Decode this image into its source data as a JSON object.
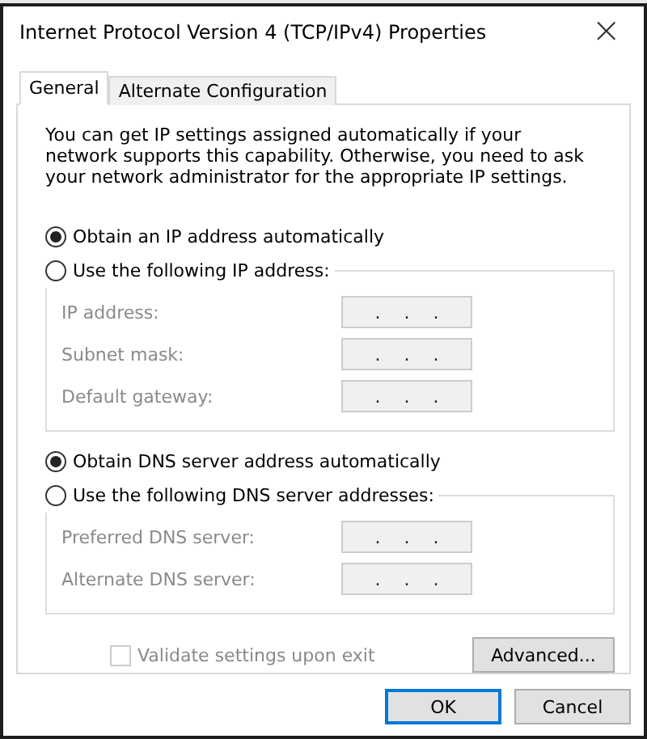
{
  "window": {
    "title": "Internet Protocol Version 4 (TCP/IPv4) Properties",
    "close": "×"
  },
  "tabs": [
    {
      "label": "General",
      "selected": true
    },
    {
      "label": "Alternate Configuration",
      "selected": false
    }
  ],
  "description": "You can get IP settings assigned automatically if your network supports this capability. Otherwise, you need to ask your network administrator for the appropriate IP settings.",
  "ip_section": {
    "auto_option": {
      "label": "Obtain an IP address automatically",
      "selected": true
    },
    "manual_option": {
      "label": "Use the following IP address:",
      "selected": false
    },
    "fields": [
      {
        "label": "IP address:",
        "value": ". . .",
        "disabled": true
      },
      {
        "label": "Subnet mask:",
        "value": ". . .",
        "disabled": true
      },
      {
        "label": "Default gateway:",
        "value": ". . .",
        "disabled": true
      }
    ]
  },
  "dns_section": {
    "auto_option": {
      "label": "Obtain DNS server address automatically",
      "selected": true
    },
    "manual_option": {
      "label": "Use the following DNS server addresses:",
      "selected": false
    },
    "fields": [
      {
        "label": "Preferred DNS server:",
        "value": ". . .",
        "disabled": true
      },
      {
        "label": "Alternate DNS server:",
        "value": ". . .",
        "disabled": true
      }
    ]
  },
  "validate": {
    "label": "Validate settings upon exit",
    "checked": false,
    "disabled": true
  },
  "advanced_button": "Advanced...",
  "buttons": [
    {
      "label": "OK",
      "default": true
    },
    {
      "label": "Cancel",
      "default": false
    }
  ]
}
